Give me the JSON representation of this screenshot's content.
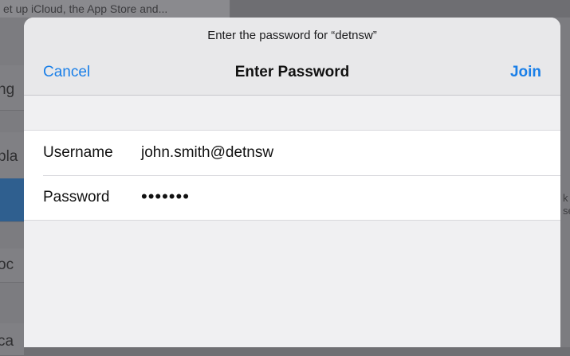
{
  "background": {
    "header_text": "et up iCloud, the App Store and...",
    "left_fragments": [
      "ng",
      "pla",
      "",
      "oc",
      "ca"
    ],
    "right_fragments": [
      "k",
      "se"
    ]
  },
  "dialog": {
    "prompt": "Enter the password for “detnsw”",
    "cancel_label": "Cancel",
    "title": "Enter Password",
    "join_label": "Join",
    "accent_color": "#1a7fe8"
  },
  "form": {
    "username_label": "Username",
    "username_value": "john.smith@detnsw",
    "password_label": "Password",
    "password_value": "•••••••"
  }
}
